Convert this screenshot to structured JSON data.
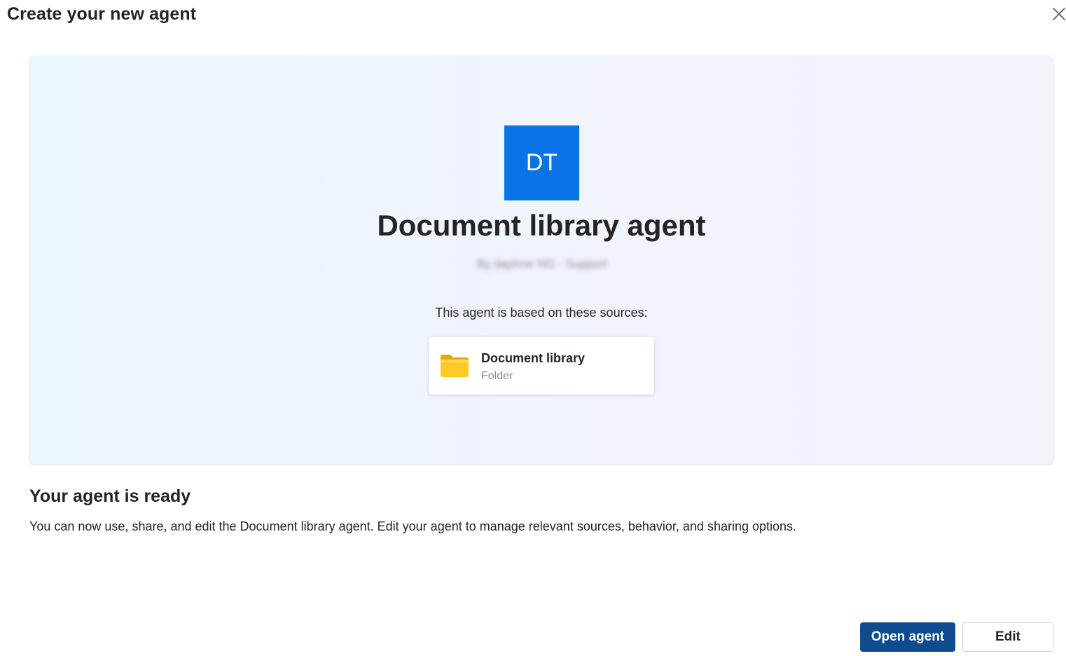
{
  "dialog": {
    "title": "Create your new agent",
    "close_icon": "close-icon"
  },
  "hero": {
    "avatar_initials": "DT",
    "avatar_color": "#0a74e6",
    "agent_name": "Document library agent",
    "author": "By daphne NG - Support",
    "sources_heading": "This agent is based on these sources:",
    "sources": [
      {
        "name": "Document library",
        "type": "Folder",
        "icon": "folder-icon"
      }
    ]
  },
  "ready": {
    "title": "Your agent is ready",
    "description": "You can now use, share, and edit the Document library agent. Edit your agent to manage relevant sources, behavior, and sharing options."
  },
  "actions": {
    "open_label": "Open agent",
    "edit_label": "Edit",
    "primary_color": "#0f4b8f"
  }
}
